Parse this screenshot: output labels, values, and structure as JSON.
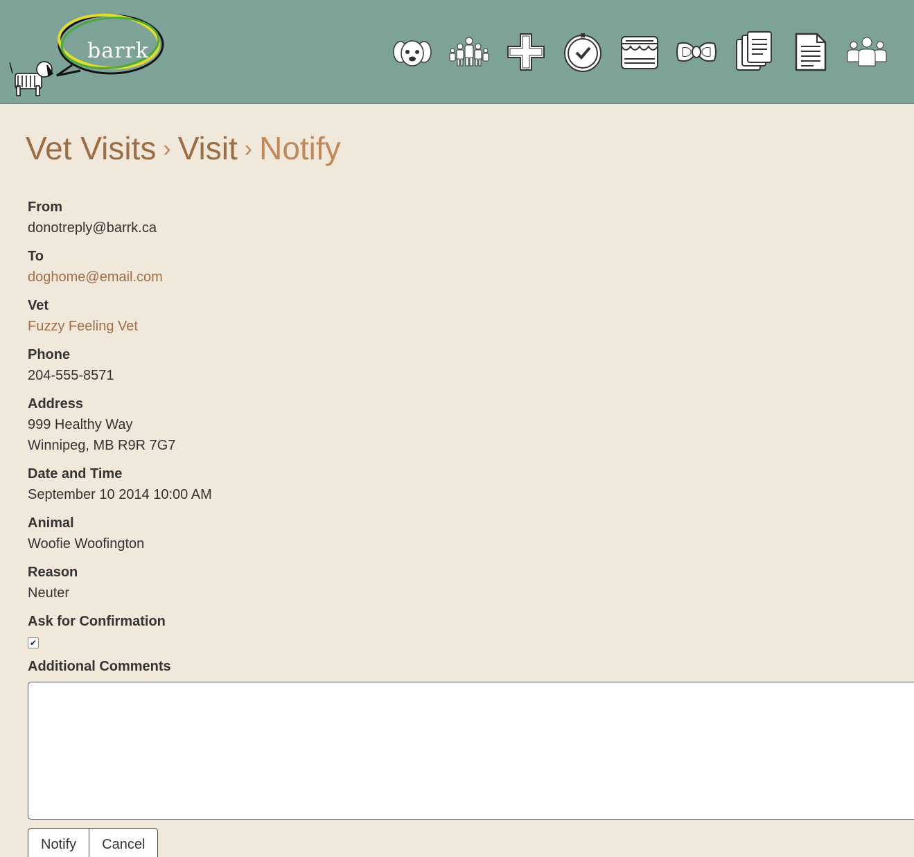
{
  "app": {
    "logo_text": "barrk"
  },
  "nav": {
    "icons": [
      "dog-icon",
      "family-icon",
      "medical-cross-icon",
      "clock-check-icon",
      "store-icon",
      "bow-tie-icon",
      "documents-icon",
      "document-icon",
      "group-icon"
    ]
  },
  "breadcrumb": {
    "level1": "Vet Visits",
    "level2": "Visit",
    "level3": "Notify",
    "separator": "›"
  },
  "form": {
    "from_label": "From",
    "from_value": "donotreply@barrk.ca",
    "to_label": "To",
    "to_value": "doghome@email.com",
    "vet_label": "Vet",
    "vet_value": "Fuzzy Feeling Vet",
    "phone_label": "Phone",
    "phone_value": "204-555-8571",
    "address_label": "Address",
    "address_line1": "999 Healthy Way",
    "address_line2": "Winnipeg, MB R9R 7G7",
    "datetime_label": "Date and Time",
    "datetime_value": "September 10 2014 10:00 AM",
    "animal_label": "Animal",
    "animal_value": "Woofie Woofington",
    "reason_label": "Reason",
    "reason_value": "Neuter",
    "confirm_label": "Ask for Confirmation",
    "confirm_checked": true,
    "confirm_mark": "✔",
    "comments_label": "Additional Comments",
    "comments_value": ""
  },
  "actions": {
    "notify_label": "Notify",
    "cancel_label": "Cancel"
  },
  "colors": {
    "header_bg": "#7da399",
    "page_bg": "#f1e8dc",
    "link": "#a36e43",
    "title": "#9c6d43"
  }
}
